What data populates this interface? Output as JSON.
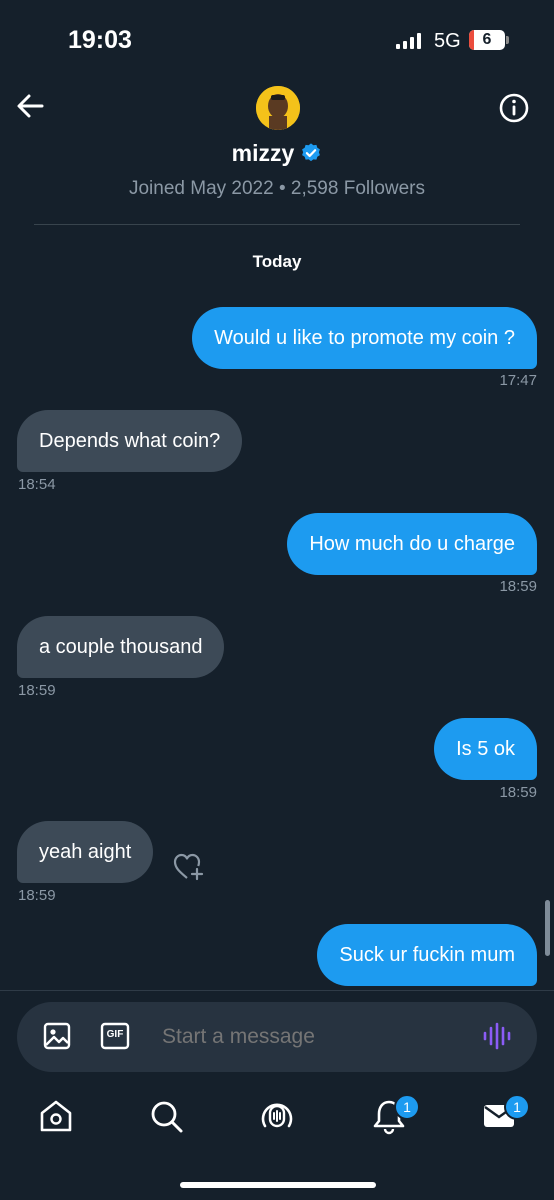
{
  "status_bar": {
    "time": "19:03",
    "network": "5G",
    "battery": "6"
  },
  "header": {
    "name": "mizzy",
    "info": "Joined May 2022 • 2,598 Followers",
    "date_divider": "Today",
    "verified_color": "#1d9bf0"
  },
  "messages": [
    {
      "text": "Would u like to promote my coin ?",
      "time": "17:47",
      "direction": "outgoing"
    },
    {
      "text": "Depends what coin?",
      "time": "18:54",
      "direction": "incoming"
    },
    {
      "text": "How much do u charge",
      "time": "18:59",
      "direction": "outgoing"
    },
    {
      "text": "a couple thousand",
      "time": "18:59",
      "direction": "incoming"
    },
    {
      "text": "Is 5 ok",
      "time": "18:59",
      "direction": "outgoing"
    },
    {
      "text": "yeah aight",
      "time": "18:59",
      "direction": "incoming"
    },
    {
      "text": "Suck ur fuckin mum",
      "direction": "outgoing"
    }
  ],
  "composer": {
    "placeholder": "Start a message",
    "gif_label": "GIF"
  },
  "nav": {
    "items": [
      "home-icon",
      "search-icon",
      "spaces-icon",
      "notifications-icon",
      "messages-icon"
    ],
    "notifications_badge": "1",
    "messages_badge": "1"
  },
  "colors": {
    "background": "#15202b",
    "outgoing_bubble": "#1d9bf0",
    "incoming_bubble": "#3d4a57",
    "voice_icon": "#8b5cf6"
  }
}
